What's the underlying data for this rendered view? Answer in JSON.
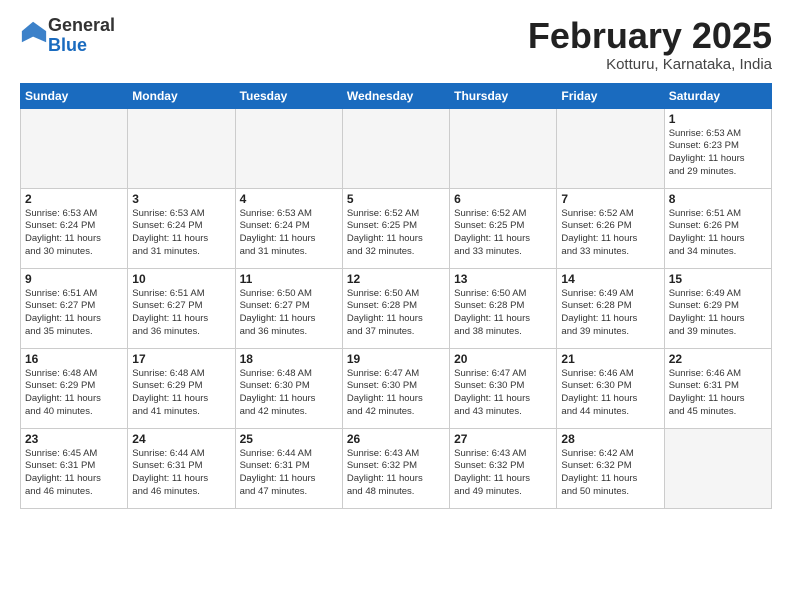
{
  "header": {
    "logo_general": "General",
    "logo_blue": "Blue",
    "month_title": "February 2025",
    "location": "Kotturu, Karnataka, India"
  },
  "days_of_week": [
    "Sunday",
    "Monday",
    "Tuesday",
    "Wednesday",
    "Thursday",
    "Friday",
    "Saturday"
  ],
  "weeks": [
    [
      {
        "day": "",
        "info": ""
      },
      {
        "day": "",
        "info": ""
      },
      {
        "day": "",
        "info": ""
      },
      {
        "day": "",
        "info": ""
      },
      {
        "day": "",
        "info": ""
      },
      {
        "day": "",
        "info": ""
      },
      {
        "day": "1",
        "info": "Sunrise: 6:53 AM\nSunset: 6:23 PM\nDaylight: 11 hours\nand 29 minutes."
      }
    ],
    [
      {
        "day": "2",
        "info": "Sunrise: 6:53 AM\nSunset: 6:24 PM\nDaylight: 11 hours\nand 30 minutes."
      },
      {
        "day": "3",
        "info": "Sunrise: 6:53 AM\nSunset: 6:24 PM\nDaylight: 11 hours\nand 31 minutes."
      },
      {
        "day": "4",
        "info": "Sunrise: 6:53 AM\nSunset: 6:24 PM\nDaylight: 11 hours\nand 31 minutes."
      },
      {
        "day": "5",
        "info": "Sunrise: 6:52 AM\nSunset: 6:25 PM\nDaylight: 11 hours\nand 32 minutes."
      },
      {
        "day": "6",
        "info": "Sunrise: 6:52 AM\nSunset: 6:25 PM\nDaylight: 11 hours\nand 33 minutes."
      },
      {
        "day": "7",
        "info": "Sunrise: 6:52 AM\nSunset: 6:26 PM\nDaylight: 11 hours\nand 33 minutes."
      },
      {
        "day": "8",
        "info": "Sunrise: 6:51 AM\nSunset: 6:26 PM\nDaylight: 11 hours\nand 34 minutes."
      }
    ],
    [
      {
        "day": "9",
        "info": "Sunrise: 6:51 AM\nSunset: 6:27 PM\nDaylight: 11 hours\nand 35 minutes."
      },
      {
        "day": "10",
        "info": "Sunrise: 6:51 AM\nSunset: 6:27 PM\nDaylight: 11 hours\nand 36 minutes."
      },
      {
        "day": "11",
        "info": "Sunrise: 6:50 AM\nSunset: 6:27 PM\nDaylight: 11 hours\nand 36 minutes."
      },
      {
        "day": "12",
        "info": "Sunrise: 6:50 AM\nSunset: 6:28 PM\nDaylight: 11 hours\nand 37 minutes."
      },
      {
        "day": "13",
        "info": "Sunrise: 6:50 AM\nSunset: 6:28 PM\nDaylight: 11 hours\nand 38 minutes."
      },
      {
        "day": "14",
        "info": "Sunrise: 6:49 AM\nSunset: 6:28 PM\nDaylight: 11 hours\nand 39 minutes."
      },
      {
        "day": "15",
        "info": "Sunrise: 6:49 AM\nSunset: 6:29 PM\nDaylight: 11 hours\nand 39 minutes."
      }
    ],
    [
      {
        "day": "16",
        "info": "Sunrise: 6:48 AM\nSunset: 6:29 PM\nDaylight: 11 hours\nand 40 minutes."
      },
      {
        "day": "17",
        "info": "Sunrise: 6:48 AM\nSunset: 6:29 PM\nDaylight: 11 hours\nand 41 minutes."
      },
      {
        "day": "18",
        "info": "Sunrise: 6:48 AM\nSunset: 6:30 PM\nDaylight: 11 hours\nand 42 minutes."
      },
      {
        "day": "19",
        "info": "Sunrise: 6:47 AM\nSunset: 6:30 PM\nDaylight: 11 hours\nand 42 minutes."
      },
      {
        "day": "20",
        "info": "Sunrise: 6:47 AM\nSunset: 6:30 PM\nDaylight: 11 hours\nand 43 minutes."
      },
      {
        "day": "21",
        "info": "Sunrise: 6:46 AM\nSunset: 6:30 PM\nDaylight: 11 hours\nand 44 minutes."
      },
      {
        "day": "22",
        "info": "Sunrise: 6:46 AM\nSunset: 6:31 PM\nDaylight: 11 hours\nand 45 minutes."
      }
    ],
    [
      {
        "day": "23",
        "info": "Sunrise: 6:45 AM\nSunset: 6:31 PM\nDaylight: 11 hours\nand 46 minutes."
      },
      {
        "day": "24",
        "info": "Sunrise: 6:44 AM\nSunset: 6:31 PM\nDaylight: 11 hours\nand 46 minutes."
      },
      {
        "day": "25",
        "info": "Sunrise: 6:44 AM\nSunset: 6:31 PM\nDaylight: 11 hours\nand 47 minutes."
      },
      {
        "day": "26",
        "info": "Sunrise: 6:43 AM\nSunset: 6:32 PM\nDaylight: 11 hours\nand 48 minutes."
      },
      {
        "day": "27",
        "info": "Sunrise: 6:43 AM\nSunset: 6:32 PM\nDaylight: 11 hours\nand 49 minutes."
      },
      {
        "day": "28",
        "info": "Sunrise: 6:42 AM\nSunset: 6:32 PM\nDaylight: 11 hours\nand 50 minutes."
      },
      {
        "day": "",
        "info": ""
      }
    ]
  ]
}
